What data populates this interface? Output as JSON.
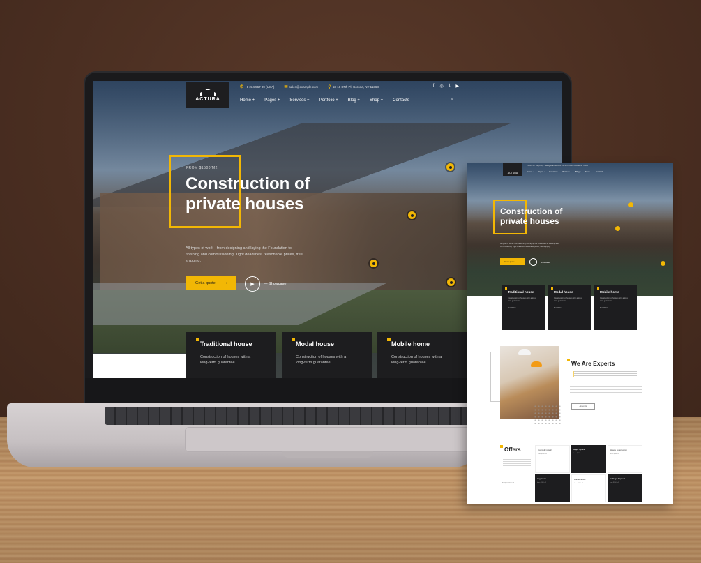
{
  "laptop_site": {
    "logo": "ACTURA",
    "topbar": {
      "phone": "+1 234 567 89 (USA)",
      "email": "sales@example.com",
      "address": "63-18 87th Pl, Corona, NY 11368"
    },
    "nav": [
      "Home +",
      "Pages +",
      "Services +",
      "Portfolio +",
      "Blog +",
      "Shop +",
      "Contacts"
    ],
    "hero": {
      "eyebrow": "FROM $1500/M2",
      "title": "Construction of private houses",
      "description": "All types of work - from designing and laying the Foundation to finishing and commissioning. Tight deadlines, reasonable prices, free shipping.",
      "cta": "Get a quote",
      "showcase": "Showcase"
    },
    "cards": [
      {
        "title": "Traditional house",
        "text": "Construction of houses with a long-term guarantee"
      },
      {
        "title": "Modal house",
        "text": "Construction of houses with a long-term guarantee"
      },
      {
        "title": "Mobile home",
        "text": "Construction of houses with a long-term guarantee"
      }
    ]
  },
  "page_preview": {
    "hero_title": "Construction of private houses",
    "cta": "Get a quote",
    "showcase": "Showcase",
    "cards": [
      {
        "title": "Traditional house",
        "text": "Construction of houses with a long-term guarantee",
        "more": "Read More"
      },
      {
        "title": "Modal house",
        "text": "Construction of houses with a long-term guarantee",
        "more": "Read More"
      },
      {
        "title": "Mobile home",
        "text": "Construction of houses with a long-term guarantee",
        "more": "Read More"
      }
    ],
    "experts_title": "We Are Experts",
    "experts_button": "About Us",
    "offers_title": "Offers",
    "offers": [
      {
        "label": "Cosmetic repairs",
        "sub": "from $900 m²"
      },
      {
        "label": "Major repairs",
        "sub": "from $900 m²"
      },
      {
        "label": "House construction",
        "sub": "from $900 m²"
      },
      {
        "label": "Log house",
        "sub": "from $900 m²"
      },
      {
        "label": "Frame house",
        "sub": "from $900 m²"
      },
      {
        "label": "Garbage disposal",
        "sub": "from $900 m²"
      }
    ],
    "design_project": "Design project"
  },
  "colors": {
    "accent": "#f2b705",
    "dark": "#1d1d1f",
    "wall": "#4a2f22"
  }
}
